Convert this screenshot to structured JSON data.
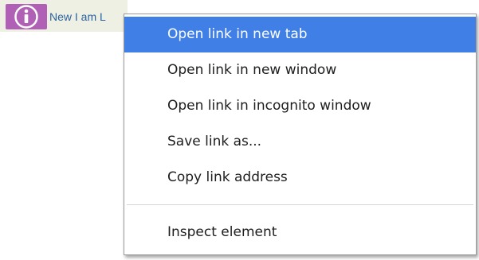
{
  "link": {
    "icon": "info-circle-icon",
    "text": "New I am L",
    "text_color": "#2a63a0",
    "icon_color": "#b061b6"
  },
  "context_menu": {
    "highlight_color": "#3f7fe6",
    "items": [
      {
        "label": "Open link in new tab",
        "highlighted": true
      },
      {
        "label": "Open link in new window",
        "highlighted": false
      },
      {
        "label": "Open link in incognito window",
        "highlighted": false
      },
      {
        "label": "Save link as...",
        "highlighted": false
      },
      {
        "label": "Copy link address",
        "highlighted": false
      }
    ],
    "footer_items": [
      {
        "label": "Inspect element",
        "highlighted": false
      }
    ]
  }
}
